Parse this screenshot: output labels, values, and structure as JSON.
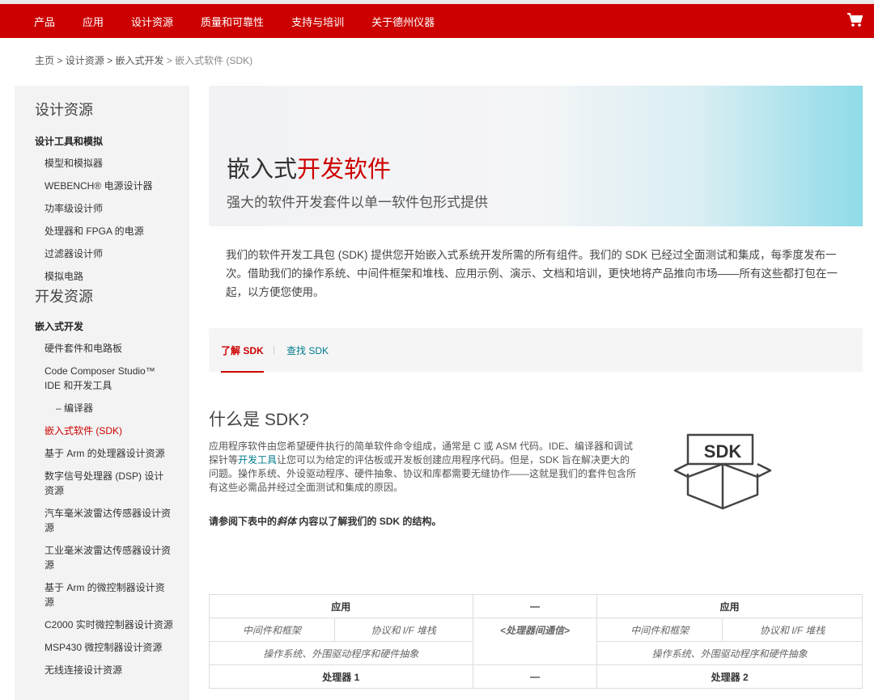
{
  "nav": {
    "items": [
      "产品",
      "应用",
      "设计资源",
      "质量和可靠性",
      "支持与培训",
      "关于德州仪器"
    ],
    "cart_icon": "shopping-cart-icon",
    "brand_color": "#cc0000"
  },
  "breadcrumb": {
    "items": [
      "主页",
      "设计资源",
      "嵌入式开发"
    ],
    "current": "嵌入式软件 (SDK)",
    "sep": ">"
  },
  "sidebar": {
    "section1": "设计资源",
    "group1": "设计工具和模拟",
    "group1_items": [
      "模型和模拟器",
      "WEBENCH® 电源设计器",
      "功率级设计师",
      "处理器和 FPGA 的电源",
      "过滤器设计师",
      "模拟电路"
    ],
    "section2": "开发资源",
    "group2": "嵌入式开发",
    "group2_items": [
      "硬件套件和电路板",
      "Code Composer Studio™ IDE 和开发工具",
      "– 编译器",
      "嵌入式软件 (SDK)",
      "基于 Arm 的处理器设计资源",
      "数字信号处理器 (DSP) 设计资源",
      "汽车毫米波雷达传感器设计资源",
      "工业毫米波雷达传感器设计资源",
      "基于 Arm 的微控制器设计资源",
      "C2000 实时微控制器设计资源",
      "MSP430 微控制器设计资源",
      "无线连接设计资源"
    ]
  },
  "hero": {
    "title_plain": "嵌入式",
    "title_red": "开发软件",
    "subtitle": "强大的软件开发套件以单一软件包形式提供"
  },
  "intro": "我们的软件开发工具包 (SDK) 提供您开始嵌入式系统开发所需的所有组件。我们的 SDK 已经过全面测试和集成，每季度发布一次。借助我们的操作系统、中间件框架和堆栈、应用示例、演示、文档和培训，更快地将产品推向市场——所有这些都打包在一起，以方便您使用。",
  "tabs": [
    "了解 SDK",
    "查找 SDK"
  ],
  "what": {
    "heading": "什么是 SDK?",
    "p1": "应用程序软件由您希望硬件执行的简单软件命令组成，通常是 C 或 ASM 代码。IDE、编译器和调试探针等",
    "link": "开发工具",
    "p2": "让您可以为给定的评估板或开发板创建应用程序代码。但是，SDK 旨在解决更大的问题。操作系统、外设驱动程序、硬件抽象、协议和库都需要无缝协作——这就是我们的套件包含所有这些必需品并经过全面测试和集成的原因。",
    "note1": "请参阅下表中的",
    "note_italic": "斜体",
    "note2": "内容以了解我们的 SDK 的结构。",
    "icon_label": "SDK"
  },
  "table": {
    "app": "应用",
    "dash": "—",
    "mw": "中间件和框架",
    "proto": "协议和 I/F 堆栈",
    "ipc": "<处理器间通信>",
    "os": "操作系统、外围驱动程序和硬件抽象",
    "p1": "处理器 1",
    "p2": "处理器 2"
  }
}
